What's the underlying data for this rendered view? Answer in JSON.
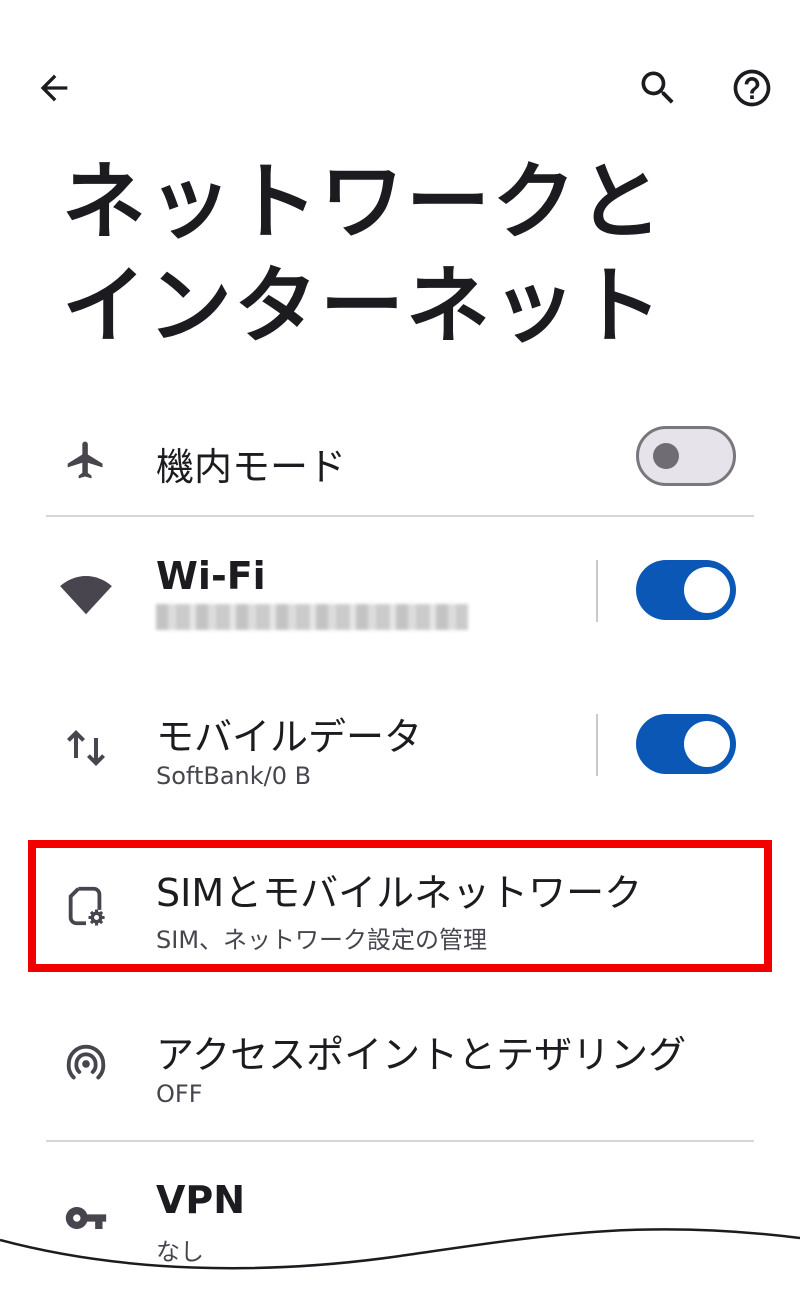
{
  "icons": {
    "back": "arrow-left-icon",
    "search": "search-icon",
    "help": "help-circle-icon"
  },
  "page": {
    "title_line1": "ネットワークと",
    "title_line2": "インターネット"
  },
  "items": {
    "airplane": {
      "icon": "airplane-icon",
      "title": "機内モード",
      "toggle": "off"
    },
    "wifi": {
      "icon": "wifi-icon",
      "title": "Wi-Fi",
      "toggle": "on"
    },
    "mobile_data": {
      "icon": "data-arrows-icon",
      "title": "モバイルデータ",
      "subtitle": "SoftBank/0 B",
      "toggle": "on"
    },
    "sim": {
      "icon": "sim-settings-icon",
      "title": "SIMとモバイルネットワーク",
      "subtitle": "SIM、ネットワーク設定の管理"
    },
    "hotspot": {
      "icon": "hotspot-icon",
      "title": "アクセスポイントとテザリング",
      "subtitle": "OFF"
    },
    "vpn": {
      "icon": "key-icon",
      "title": "VPN",
      "subtitle": "なし"
    }
  },
  "colors": {
    "toggle_on": "#0b57b6",
    "highlight": "#f20000"
  }
}
